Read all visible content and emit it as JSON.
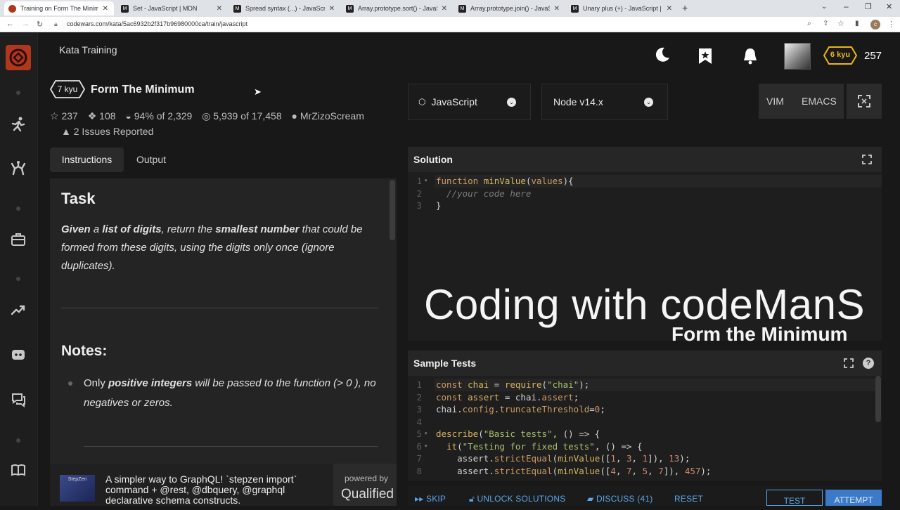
{
  "browser": {
    "tabs": [
      {
        "label": "Training on Form The Minimum |",
        "icon": "codewars-icon",
        "active": true
      },
      {
        "label": "Set - JavaScript | MDN",
        "icon": "mdn-icon",
        "active": false
      },
      {
        "label": "Spread syntax (...) - JavaScript | M",
        "icon": "mdn-icon",
        "active": false
      },
      {
        "label": "Array.prototype.sort() - JavaScrip",
        "icon": "mdn-icon",
        "active": false
      },
      {
        "label": "Array.prototype.join() - JavaScrip",
        "icon": "mdn-icon",
        "active": false
      },
      {
        "label": "Unary plus (+) - JavaScript | MDN",
        "icon": "mdn-icon",
        "active": false
      }
    ],
    "url": "codewars.com/kata/5ac6932b2f317b96980000ca/train/javascript",
    "profile_initial": "c"
  },
  "header": {
    "section_title": "Kata Training",
    "rank_badge": "6 kyu",
    "honor": "257"
  },
  "kata": {
    "kyu": "7 kyu",
    "title": "Form The Minimum",
    "stars": "237",
    "collections": "108",
    "satisfaction": "94%",
    "satisfaction_of": "of 2,329",
    "completed": "5,939",
    "completed_of": "of 17,458",
    "author": "MrZizoScream",
    "issues": "2 Issues Reported"
  },
  "tabs": {
    "instructions": "Instructions",
    "output": "Output"
  },
  "instructions": {
    "task_heading": "Task",
    "given": "Given",
    "a": " a ",
    "list_of_digits": "list of digits",
    "return_the": ", return the ",
    "smallest_number": "smallest number",
    "rest": " that could be formed from these digits, using the digits only once (ignore duplicates).",
    "notes_heading": "Notes:",
    "only": "Only ",
    "positive_integers": "positive integers",
    "note_rest": " will be passed to the function (> 0 ), no negatives or zeros."
  },
  "ad": {
    "thumb_label": "StepZen",
    "text": "A simpler way to GraphQL! `stepzen import` command + @rest, @dbquery, @graphql declarative schema constructs.",
    "powered_by": "powered by",
    "brand": "Qualified"
  },
  "editor": {
    "language": "JavaScript",
    "runtime": "Node v14.x",
    "vim": "VIM",
    "emacs": "EMACS",
    "solution_title": "Solution",
    "sample_tests_title": "Sample Tests"
  },
  "overlay": {
    "title": "Coding with codeManS",
    "subtitle": "Form the Minimum"
  },
  "bottom": {
    "skip": "SKIP",
    "unlock": "UNLOCK SOLUTIONS",
    "discuss": "DISCUSS (41)",
    "reset": "RESET",
    "test": "TEST",
    "attempt": "ATTEMPT"
  }
}
